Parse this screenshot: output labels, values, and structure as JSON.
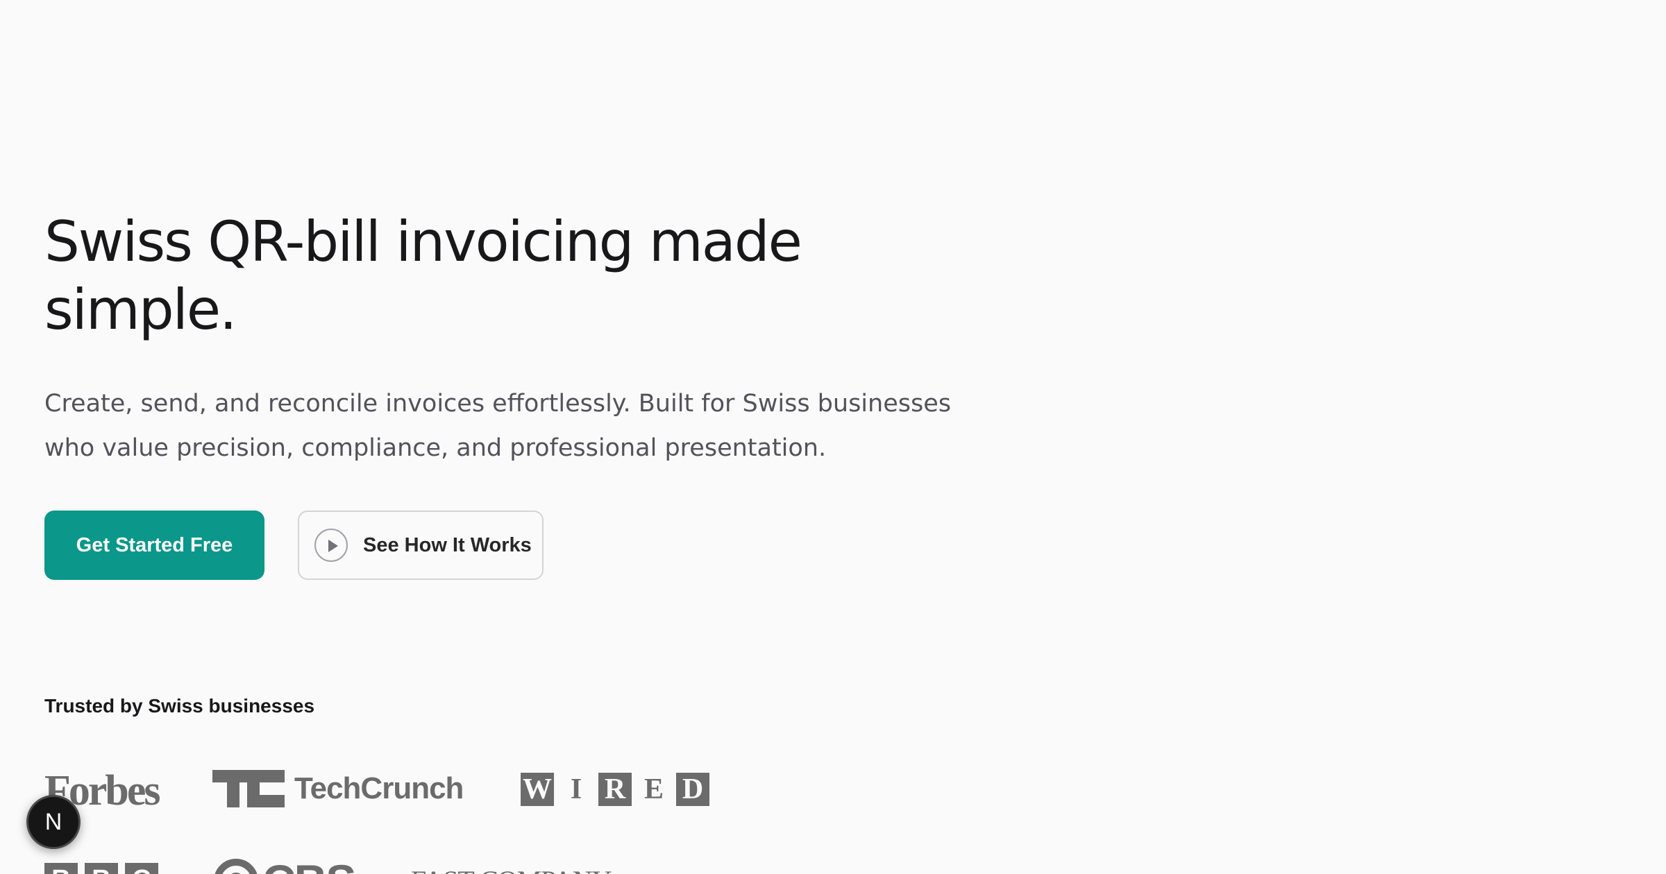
{
  "hero": {
    "title": "Swiss QR-bill invoicing made simple.",
    "subtitle": "Create, send, and reconcile invoices effortlessly. Built for Swiss businesses who value precision, compliance, and professional presentation."
  },
  "cta": {
    "primary_label": "Get Started Free",
    "secondary_label": "See How It Works",
    "secondary_icon": "play-circle-icon"
  },
  "trusted": {
    "label": "Trusted by Swiss businesses",
    "logos": {
      "forbes": "Forbes",
      "techcrunch": "TechCrunch",
      "wired": [
        "W",
        "I",
        "R",
        "E",
        "D"
      ],
      "bbc": [
        "B",
        "B",
        "C"
      ],
      "cbs": "CBS",
      "fastcompany": "FAST COMPANY"
    }
  },
  "dev_badge": {
    "letter": "N"
  },
  "colors": {
    "accent": "#0b978a",
    "background": "#fafafa",
    "logo_gray": "#6b6b6b"
  }
}
